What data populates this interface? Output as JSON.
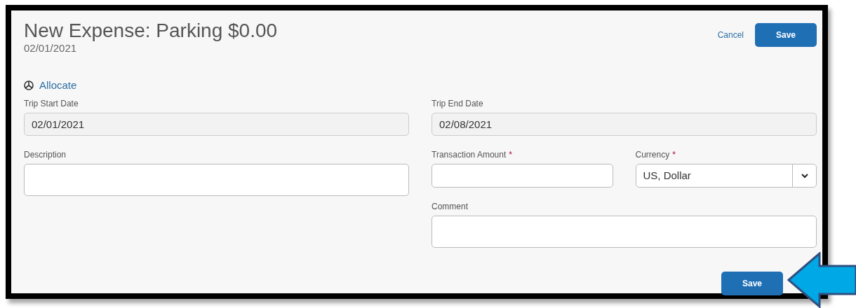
{
  "header": {
    "title": "New Expense: Parking $0.00",
    "date": "02/01/2021",
    "actions": [
      {
        "kind": "link",
        "label": "Cancel"
      },
      {
        "kind": "primary",
        "label": "Save"
      }
    ]
  },
  "allocate": {
    "label": "Allocate"
  },
  "columns": [
    {
      "fields": [
        {
          "kind": "readonly",
          "label": "Trip Start Date",
          "value": "02/01/2021"
        },
        {
          "kind": "textarea",
          "label": "Description"
        }
      ]
    },
    {
      "fields": [
        {
          "kind": "readonly",
          "label": "Trip End Date",
          "value": "02/08/2021"
        },
        {
          "kind": "pair",
          "fields": [
            {
              "kind": "text",
              "label": "Transaction Amount",
              "required_mark": "*"
            },
            {
              "kind": "select",
              "label": "Currency",
              "required_mark": "*",
              "value": "US, Dollar"
            }
          ]
        },
        {
          "kind": "textarea",
          "label": "Comment"
        }
      ]
    }
  ],
  "footer": {
    "actions": [
      {
        "kind": "primary",
        "label": "Save"
      }
    ]
  }
}
